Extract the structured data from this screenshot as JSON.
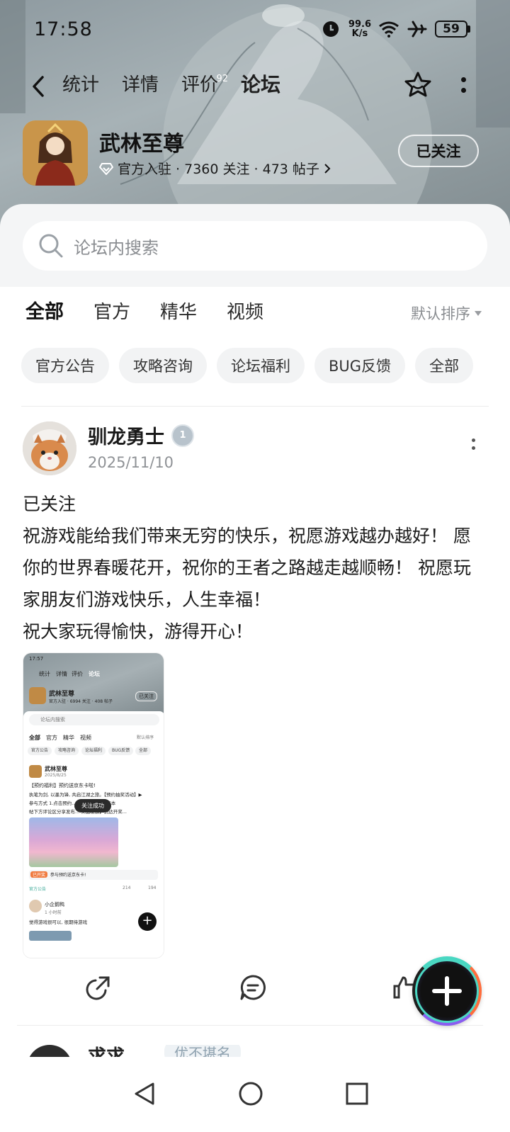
{
  "status_bar": {
    "time": "17:58",
    "net_speed_value": "99.6",
    "net_speed_unit": "K/s",
    "battery": "59",
    "icons": [
      "alarm-icon",
      "wifi-icon",
      "airplane-icon",
      "battery-icon"
    ]
  },
  "nav": {
    "tabs": [
      {
        "label": "统计",
        "active": false
      },
      {
        "label": "详情",
        "active": false
      },
      {
        "label": "评价",
        "active": false,
        "badge": "92"
      },
      {
        "label": "论坛",
        "active": true
      }
    ]
  },
  "game": {
    "name": "武林至尊",
    "meta": "官方入驻 · 7360 关注 · 473 帖子",
    "follow_label": "已关注"
  },
  "search": {
    "placeholder": "论坛内搜索"
  },
  "category_tabs": [
    {
      "label": "全部",
      "active": true
    },
    {
      "label": "官方",
      "active": false
    },
    {
      "label": "精华",
      "active": false
    },
    {
      "label": "视频",
      "active": false
    }
  ],
  "sort_label": "默认排序",
  "chips": [
    "官方公告",
    "攻略咨询",
    "论坛福利",
    "BUG反馈",
    "全部"
  ],
  "post": {
    "author": "驯龙勇士",
    "level_badge": "1",
    "date": "2025/11/10",
    "paragraphs": [
      "已关注",
      "祝游戏能给我们带来无穷的快乐，祝愿游戏越办越好！ 愿你的世界春暖花开，祝你的王者之路越走越顺畅！ 祝愿玩家朋友们游戏快乐，人生幸福！",
      "祝大家玩得愉快，游得开心！"
    ],
    "screenshot": {
      "time": "17:57",
      "tabs": [
        "统计",
        "详情",
        "评价",
        "论坛"
      ],
      "game_name": "武林至尊",
      "game_meta": "官方入驻 · 6994 关注 · 408 帖子",
      "follow": "已关注",
      "search": "论坛内搜索",
      "cat_tabs": [
        "全部",
        "官方",
        "精华",
        "视频"
      ],
      "sort": "默认排序",
      "chips": [
        "官方公告",
        "攻略咨询",
        "论坛福利",
        "BUG反馈",
        "全部"
      ],
      "post1_author": "武林至尊",
      "post1_date": "2025/8/25",
      "post1_line1": "【预约福利】预约送京东卡啦!",
      "post1_line2": "执笔为剑, 以墨为锋, 共启江湖之旅。【预约抽奖活动】▶",
      "post1_line3": "参与方式 1.点击预约... 新帖晒截图 2.在本",
      "post1_line4": "帖下方评论区分享发布... 奖品发放】到达开奖...",
      "toast": "关注成功",
      "banner_tag": "已开奖",
      "banner_text": "参与预约送京东卡!",
      "board": "官方公告",
      "comments": "214",
      "likes": "194",
      "post2_author": "小企鹅鸭",
      "post2_time": "1 小时前",
      "post2_text": "觉得游戏很可以, 很期待游戏"
    }
  },
  "next_post": {
    "author": "求求",
    "tag": "优不堪名"
  },
  "colors": {
    "accent": "#41d2bd",
    "text_primary": "#1b1b1b",
    "text_secondary": "#8f9296",
    "chip_bg": "#f2f3f4"
  }
}
